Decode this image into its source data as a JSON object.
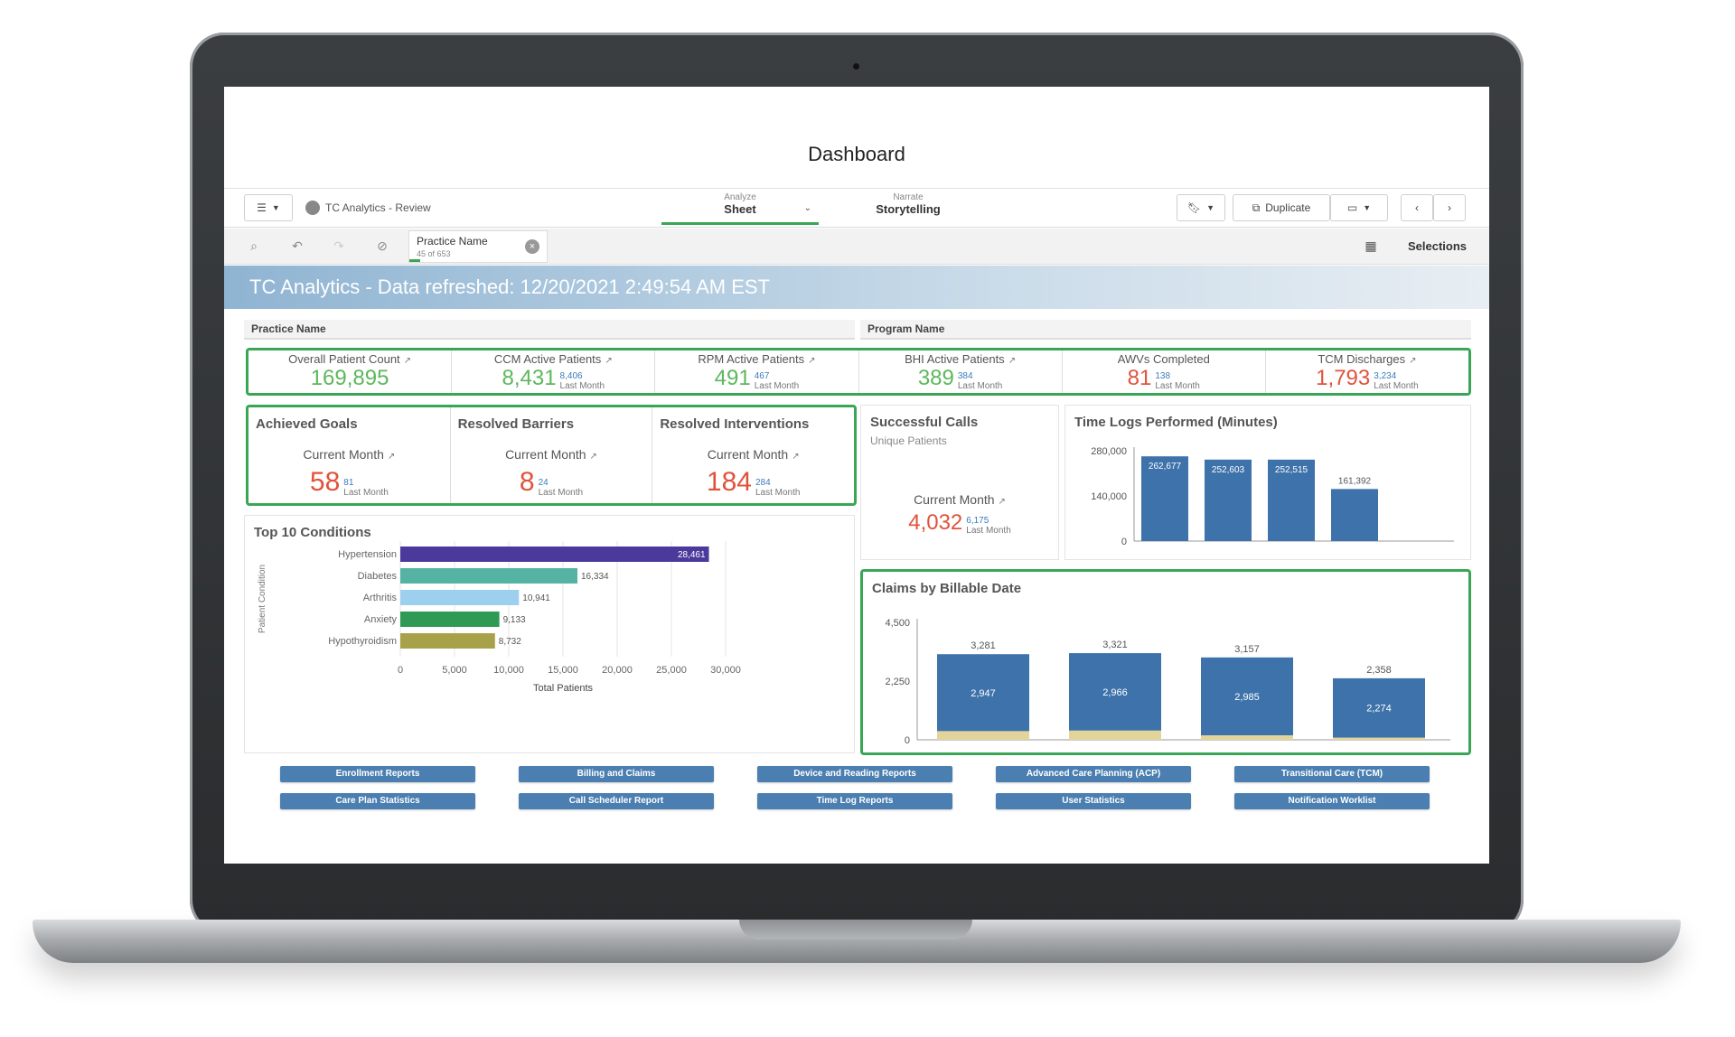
{
  "dashboard_title": "Dashboard",
  "app": {
    "name": "TC Analytics - Review"
  },
  "toolbar": {
    "analyze_small": "Analyze",
    "analyze_main": "Sheet",
    "narrate_small": "Narrate",
    "narrate_main": "Storytelling",
    "duplicate_label": "Duplicate",
    "selections_label": "Selections"
  },
  "selection_chip": {
    "label": "Practice Name",
    "count": "45 of 653"
  },
  "banner": "TC Analytics - Data refreshed: 12/20/2021 2:49:54 AM EST",
  "filters": {
    "practice": "Practice Name",
    "program": "Program Name"
  },
  "kpis": [
    {
      "title": "Overall Patient Count",
      "value": "169,895",
      "color": "#5cb85c"
    },
    {
      "title": "CCM Active Patients",
      "value": "8,431",
      "last": "8,406",
      "last_label": "Last Month",
      "color": "#5cb85c"
    },
    {
      "title": "RPM Active Patients",
      "value": "491",
      "last": "467",
      "last_label": "Last Month",
      "color": "#5cb85c"
    },
    {
      "title": "BHI Active Patients",
      "value": "389",
      "last": "384",
      "last_label": "Last Month",
      "color": "#5cb85c"
    },
    {
      "title": "AWVs Completed",
      "value": "81",
      "last": "138",
      "last_label": "Last Month",
      "color": "#e0533b"
    },
    {
      "title": "TCM Discharges",
      "value": "1,793",
      "last": "3,234",
      "last_label": "Last Month",
      "color": "#e0533b"
    }
  ],
  "goals": [
    {
      "title": "Achieved Goals",
      "cm": "Current Month",
      "value": "58",
      "last": "81",
      "last_label": "Last Month"
    },
    {
      "title": "Resolved Barriers",
      "cm": "Current Month",
      "value": "8",
      "last": "24",
      "last_label": "Last Month"
    },
    {
      "title": "Resolved Interventions",
      "cm": "Current Month",
      "value": "184",
      "last": "284",
      "last_label": "Last Month"
    }
  ],
  "calls": {
    "title": "Successful Calls",
    "subtitle": "Unique Patients",
    "cm": "Current Month",
    "value": "4,032",
    "last": "6,175",
    "last_label": "Last Month"
  },
  "chart_data": [
    {
      "type": "bar",
      "orientation": "horizontal",
      "title": "Top 10 Conditions",
      "xlabel": "Total Patients",
      "ylabel": "Patient Condition",
      "categories": [
        "Hypertension",
        "Diabetes",
        "Arthritis",
        "Anxiety",
        "Hypothyroidism"
      ],
      "values": [
        28461,
        16334,
        10941,
        9133,
        8732
      ],
      "value_labels": [
        "28,461",
        "16,334",
        "10,941",
        "9,133",
        "8,732"
      ],
      "colors": [
        "#4b3a9c",
        "#55b3a4",
        "#9dd0ee",
        "#2e9a53",
        "#a7a24a"
      ],
      "xlim": [
        0,
        30000
      ],
      "xticks": [
        "0",
        "5,000",
        "10,000",
        "15,000",
        "20,000",
        "25,000",
        "30,000"
      ],
      "grid": true
    },
    {
      "type": "bar",
      "title": "Time Logs Performed (Minutes)",
      "values": [
        262677,
        252603,
        252515,
        161392
      ],
      "value_labels": [
        "262,677",
        "252,603",
        "252,515",
        "161,392"
      ],
      "ylim": [
        0,
        280000
      ],
      "yticks": [
        "280,000",
        "140,000",
        "0"
      ],
      "color": "#3e72aa"
    },
    {
      "type": "bar",
      "stacked": true,
      "title": "Claims by Billable Date",
      "totals": [
        3281,
        3321,
        3157,
        2358
      ],
      "total_labels": [
        "3,281",
        "3,321",
        "3,157",
        "2,358"
      ],
      "series": [
        {
          "values": [
            2947,
            2966,
            2985,
            2274
          ],
          "labels": [
            "2,947",
            "2,966",
            "2,985",
            "2,274"
          ],
          "color": "#3e72aa"
        },
        {
          "values": [
            334,
            355,
            172,
            84
          ],
          "color": "#e3d59a"
        }
      ],
      "ylim": [
        0,
        4500
      ],
      "yticks": [
        "4,500",
        "2,250",
        "0"
      ]
    }
  ],
  "nav_buttons": [
    [
      "Enrollment Reports",
      "Billing and Claims",
      "Device and Reading Reports",
      "Advanced Care Planning (ACP)",
      "Transitional Care (TCM)"
    ],
    [
      "Care Plan Statistics",
      "Call Scheduler Report",
      "Time Log Reports",
      "User Statistics",
      "Notification Worklist"
    ]
  ]
}
